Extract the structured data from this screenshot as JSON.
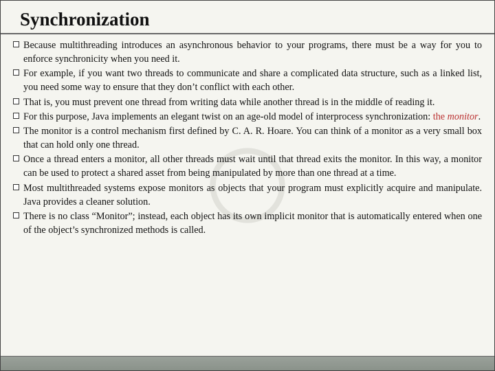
{
  "title": "Synchronization",
  "bullets": {
    "b0": "Because multithreading introduces an asynchronous behavior to your programs, there must be a way for you to enforce synchronicity when you need it.",
    "b1": "For example, if you want two threads to communicate and share a complicated data structure, such as a linked list, you need some way to ensure that they don’t conflict with each other.",
    "b2": "That is, you must prevent one thread from writing data while another thread is in the middle of reading it.",
    "b3_pre": "For this purpose, Java implements an elegant twist on an age-old model of interprocess synchronization: ",
    "b3_phrase": "the ",
    "b3_word": "monitor",
    "b3_post": ".",
    "b4": "The monitor is a control mechanism first defined by C. A. R. Hoare. You can think of a monitor as a very small box that can hold only one thread.",
    "b5": "Once a thread enters a monitor, all other threads must wait until that thread exits the monitor. In this way, a monitor can be used to protect a shared asset from being manipulated by more than one thread at a time.",
    "b6": "Most multithreaded systems expose monitors as objects that your program must explicitly acquire and manipulate. Java provides a cleaner solution.",
    "b7": "There is no class “Monitor”; instead, each object has its own implicit monitor that is automatically entered when one of the object’s synchronized methods is called."
  }
}
